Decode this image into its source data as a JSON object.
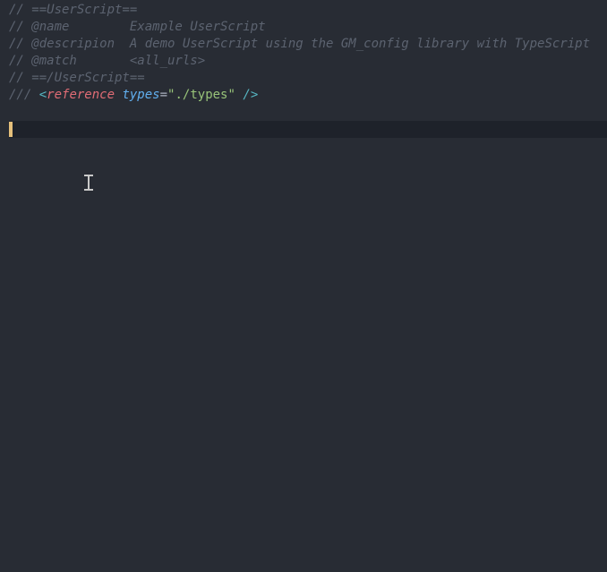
{
  "editor": {
    "lines": {
      "l1": "// ==UserScript==",
      "l2": "// @name        Example UserScript",
      "l3": "// @descripion  A demo UserScript using the GM_config library with TypeScript",
      "l4": "// @match       <all_urls>",
      "l5": "// ==/UserScript=="
    },
    "ref": {
      "slashes": "/// ",
      "openAngle": "<",
      "keyword": "reference",
      "space": " ",
      "attr": "types",
      "eq": "=",
      "q1": "\"",
      "str": "./types",
      "q2": "\"",
      "space2": " ",
      "slashClose": "/",
      "closeAngle": ">"
    }
  }
}
